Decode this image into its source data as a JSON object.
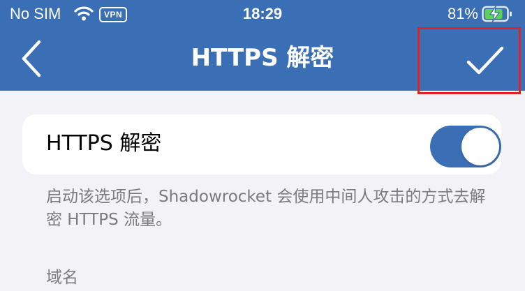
{
  "status_bar": {
    "carrier": "No SIM",
    "vpn": "VPN",
    "time": "18:29",
    "battery": "81%",
    "wifi_icon": "wifi-icon",
    "battery_icon": "battery-charging-icon"
  },
  "nav": {
    "title": "HTTPS 解密",
    "back_icon": "chevron-left-icon",
    "confirm_icon": "checkmark-icon"
  },
  "toggle": {
    "label": "HTTPS 解密",
    "state": "on"
  },
  "description": "启动该选项后，Shadowrocket 会使用中间人攻击的方式去解密 HTTPS 流量。",
  "section": {
    "label": "域名"
  },
  "colors": {
    "accent": "#3a6fb6",
    "background": "#f2f2f7",
    "highlight_box": "#e0202a"
  }
}
